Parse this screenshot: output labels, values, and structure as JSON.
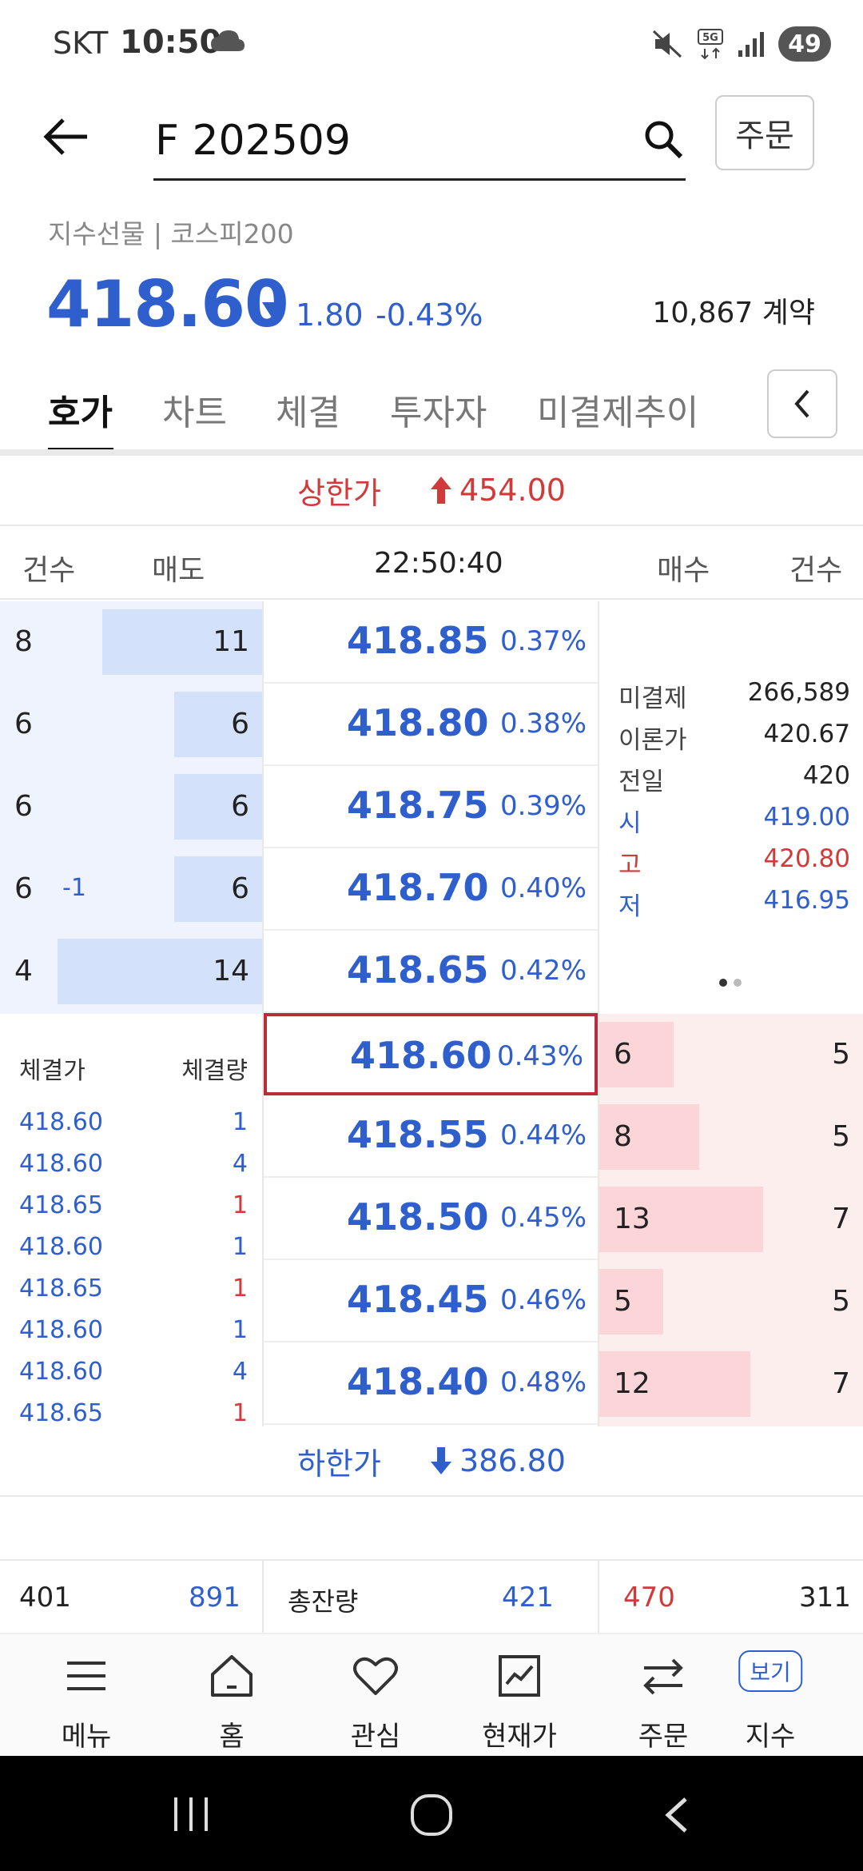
{
  "status_bar": {
    "carrier": "SKT",
    "time": "10:50",
    "battery": "49"
  },
  "header": {
    "search_text": "F 202509",
    "order_label": "주문"
  },
  "quote": {
    "category": "지수선물 | 코스피200",
    "price": "418.60",
    "change": "1.80",
    "change_rate": "-0.43%",
    "volume": "10,867 계약"
  },
  "tabs": [
    {
      "label": "호가"
    },
    {
      "label": "차트"
    },
    {
      "label": "체결"
    },
    {
      "label": "투자자"
    },
    {
      "label": "미결제추이"
    }
  ],
  "upper_limit": {
    "label": "상한가",
    "value": "454.00"
  },
  "lower_limit": {
    "label": "하한가",
    "value": "386.80"
  },
  "orderbook_header": {
    "ask_count": "건수",
    "ask": "매도",
    "time": "22:50:40",
    "bid": "매수",
    "bid_count": "건수"
  },
  "asks": [
    {
      "count": "8",
      "delta": "",
      "qty": "11",
      "bar": 0.78,
      "price": "418.85",
      "rate": "0.37%"
    },
    {
      "count": "6",
      "delta": "",
      "qty": "6",
      "bar": 0.43,
      "price": "418.80",
      "rate": "0.38%"
    },
    {
      "count": "6",
      "delta": "",
      "qty": "6",
      "bar": 0.43,
      "price": "418.75",
      "rate": "0.39%"
    },
    {
      "count": "6",
      "delta": "-1",
      "qty": "6",
      "bar": 0.43,
      "price": "418.70",
      "rate": "0.40%"
    },
    {
      "count": "4",
      "delta": "",
      "qty": "14",
      "bar": 1.0,
      "price": "418.65",
      "rate": "0.42%"
    }
  ],
  "bids": [
    {
      "qty": "6",
      "count": "5",
      "bar": 0.29,
      "price": "418.60",
      "rate": "0.43%"
    },
    {
      "qty": "8",
      "count": "5",
      "bar": 0.39,
      "price": "418.55",
      "rate": "0.44%"
    },
    {
      "qty": "13",
      "count": "7",
      "bar": 0.64,
      "price": "418.50",
      "rate": "0.45%"
    },
    {
      "qty": "5",
      "count": "5",
      "bar": 0.25,
      "price": "418.45",
      "rate": "0.46%"
    },
    {
      "qty": "12",
      "count": "7",
      "bar": 0.59,
      "price": "418.40",
      "rate": "0.48%"
    }
  ],
  "info": [
    {
      "label": "미결제",
      "value": "266,589",
      "color": "#222222",
      "label_color": "#444444"
    },
    {
      "label": "이론가",
      "value": "420.67",
      "color": "#222222",
      "label_color": "#444444"
    },
    {
      "label": "전일",
      "value": "420",
      "color": "#222222",
      "label_color": "#444444"
    },
    {
      "label": "시",
      "value": "419.00",
      "color": "#2f5fcd",
      "label_color": "#2f5fcd"
    },
    {
      "label": "고",
      "value": "420.80",
      "color": "#d23a3a",
      "label_color": "#d23a3a"
    },
    {
      "label": "저",
      "value": "416.95",
      "color": "#2f5fcd",
      "label_color": "#2f5fcd"
    }
  ],
  "trades_header": {
    "price": "체결가",
    "qty": "체결량"
  },
  "trades": [
    {
      "price": "418.60",
      "qty": "1",
      "color": "#2f5fcd"
    },
    {
      "price": "418.60",
      "qty": "4",
      "color": "#2f5fcd"
    },
    {
      "price": "418.65",
      "qty": "1",
      "color": "#d23a3a"
    },
    {
      "price": "418.60",
      "qty": "1",
      "color": "#2f5fcd"
    },
    {
      "price": "418.65",
      "qty": "1",
      "color": "#d23a3a"
    },
    {
      "price": "418.60",
      "qty": "1",
      "color": "#2f5fcd"
    },
    {
      "price": "418.60",
      "qty": "4",
      "color": "#2f5fcd"
    },
    {
      "price": "418.65",
      "qty": "1",
      "color": "#d23a3a"
    }
  ],
  "summary": {
    "ask_count_total": "401",
    "ask_total": "891",
    "label": "총잔량",
    "diff": "421",
    "bid_total": "470",
    "bid_count_total": "311"
  },
  "bottom_nav": [
    {
      "label": "메뉴",
      "icon": "menu-icon"
    },
    {
      "label": "홈",
      "icon": "home-icon"
    },
    {
      "label": "관심",
      "icon": "heart-icon"
    },
    {
      "label": "현재가",
      "icon": "chart-icon"
    },
    {
      "label": "주문",
      "icon": "swap-icon"
    },
    {
      "label": "지수",
      "icon": "index-icon",
      "badge": "보기"
    }
  ],
  "colors": {
    "blue": "#2f5fcd",
    "red": "#d23a3a",
    "ask_bg": "#eef3fd",
    "bid_bg": "#fdeeee"
  }
}
